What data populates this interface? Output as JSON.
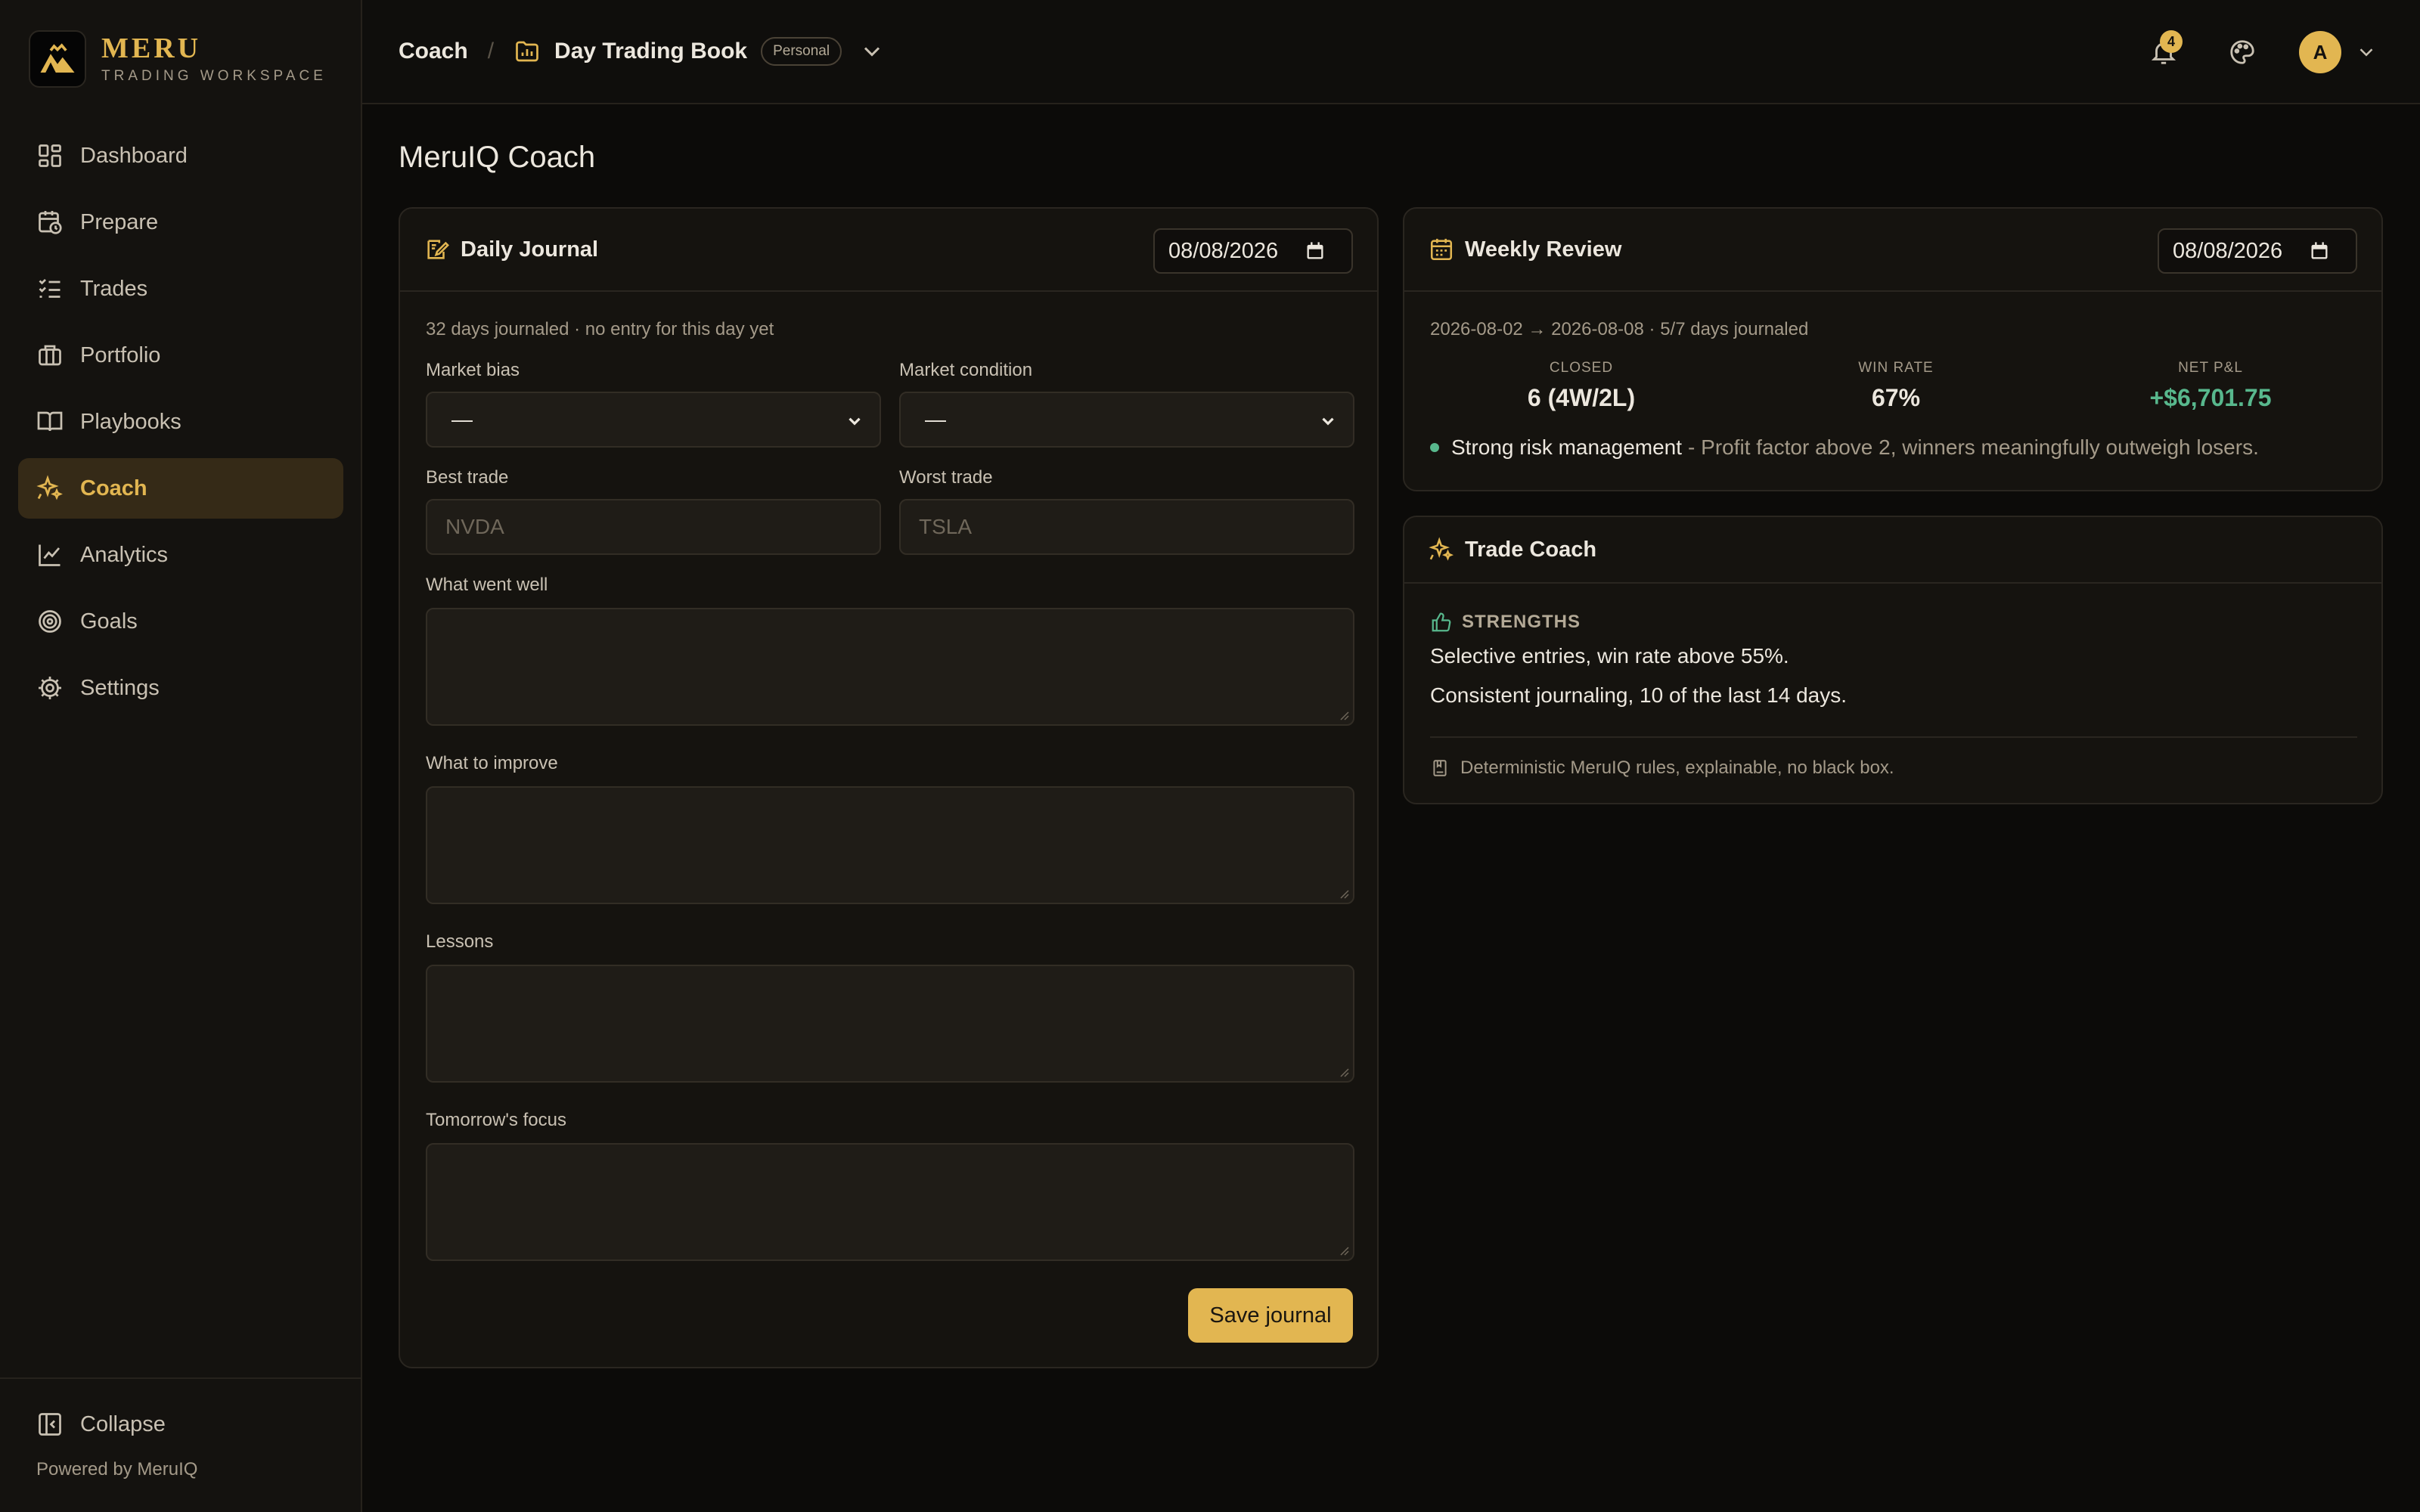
{
  "colors": {
    "accent": "#e2b651",
    "positive": "#58b88d",
    "background": "#0c0b09",
    "panel": "#15130f"
  },
  "brand": {
    "name": "MERU",
    "subtitle": "TRADING WORKSPACE",
    "logo_icon": "mountain-logo-icon"
  },
  "sidebar": {
    "items": [
      {
        "label": "Dashboard",
        "icon": "dashboard-icon",
        "active": false
      },
      {
        "label": "Prepare",
        "icon": "calendar-clock-icon",
        "active": false
      },
      {
        "label": "Trades",
        "icon": "list-check-icon",
        "active": false
      },
      {
        "label": "Portfolio",
        "icon": "briefcase-icon",
        "active": false
      },
      {
        "label": "Playbooks",
        "icon": "book-open-icon",
        "active": false
      },
      {
        "label": "Coach",
        "icon": "sparkles-icon",
        "active": true
      },
      {
        "label": "Analytics",
        "icon": "line-chart-icon",
        "active": false
      },
      {
        "label": "Goals",
        "icon": "target-icon",
        "active": false
      },
      {
        "label": "Settings",
        "icon": "gear-icon",
        "active": false
      }
    ],
    "collapse_label": "Collapse",
    "powered_by": "Powered by MeruIQ"
  },
  "header": {
    "breadcrumb_current": "Coach",
    "breadcrumb_separator": "/",
    "book_name": "Day Trading Book",
    "book_badge": "Personal",
    "notification_count": "4",
    "avatar_initial": "A"
  },
  "page": {
    "title": "MeruIQ Coach"
  },
  "journal": {
    "title": "Daily Journal",
    "date": "08/08/2026",
    "meta": "32 days journaled · no entry for this day yet",
    "market_bias_label": "Market bias",
    "market_bias_value": "—",
    "market_condition_label": "Market condition",
    "market_condition_value": "—",
    "best_trade_label": "Best trade",
    "best_trade_placeholder": "NVDA",
    "worst_trade_label": "Worst trade",
    "worst_trade_placeholder": "TSLA",
    "went_well_label": "What went well",
    "improve_label": "What to improve",
    "lessons_label": "Lessons",
    "tomorrow_label": "Tomorrow's focus",
    "save_label": "Save journal"
  },
  "weekly": {
    "title": "Weekly Review",
    "date": "08/08/2026",
    "meta": "2026-08-02 → 2026-08-08 · 5/7 days journaled",
    "stats": [
      {
        "label": "CLOSED",
        "value": "6 (4W/2L)"
      },
      {
        "label": "WIN RATE",
        "value": "67%"
      },
      {
        "label": "NET P&L",
        "value": "+$6,701.75"
      }
    ],
    "insight_title": "Strong risk management",
    "insight_text": "- Profit factor above 2, winners meaningfully outweigh losers."
  },
  "coach": {
    "title": "Trade Coach",
    "strengths_label": "STRENGTHS",
    "strengths": [
      "Selective entries, win rate above 55%.",
      "Consistent journaling, 10 of the last 14 days."
    ],
    "note": "Deterministic MeruIQ rules, explainable, no black box."
  }
}
